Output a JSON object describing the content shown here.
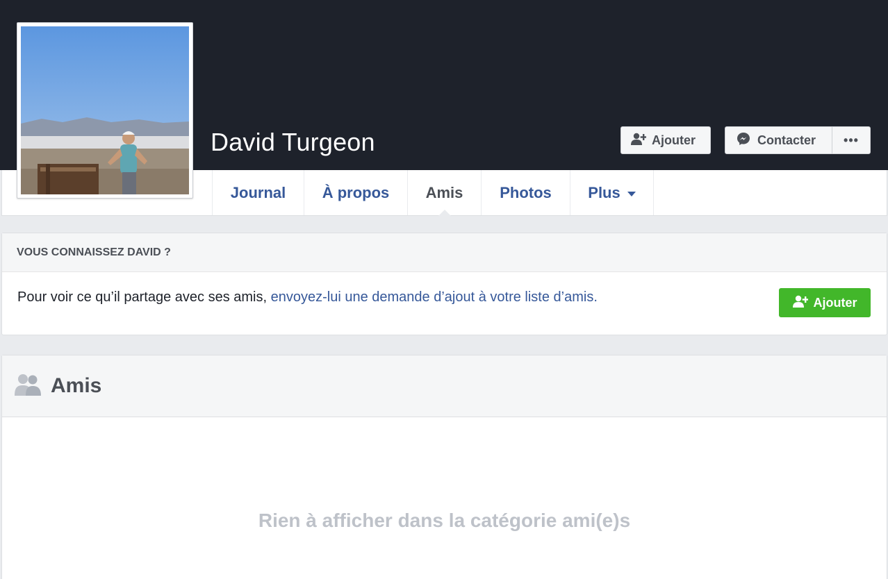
{
  "profile": {
    "name": "David Turgeon",
    "add_friend_label": "Ajouter",
    "message_label": "Contacter",
    "more_label": "•••"
  },
  "tabs": [
    {
      "label": "Journal",
      "active": false
    },
    {
      "label": "À propos",
      "active": false
    },
    {
      "label": "Amis",
      "active": true
    },
    {
      "label": "Photos",
      "active": false
    },
    {
      "label": "Plus",
      "active": false
    }
  ],
  "know_card": {
    "heading": "VOUS CONNAISSEZ DAVID ?",
    "text": "Pour voir ce qu’il partage avec ses amis,",
    "link_text": "envoyez-lui une demande d’ajout à votre liste d’amis.",
    "button_label": "Ajouter"
  },
  "friends_section": {
    "title": "Amis",
    "empty_message": "Rien à afficher dans la catégorie ami(e)s"
  },
  "icons": {
    "add_friend": "person-plus-icon",
    "messenger": "messenger-icon",
    "friends": "friends-icon"
  },
  "colors": {
    "cover": "#1e222b",
    "link": "#365899",
    "green": "#42b72a",
    "muted": "#bec2c9"
  }
}
